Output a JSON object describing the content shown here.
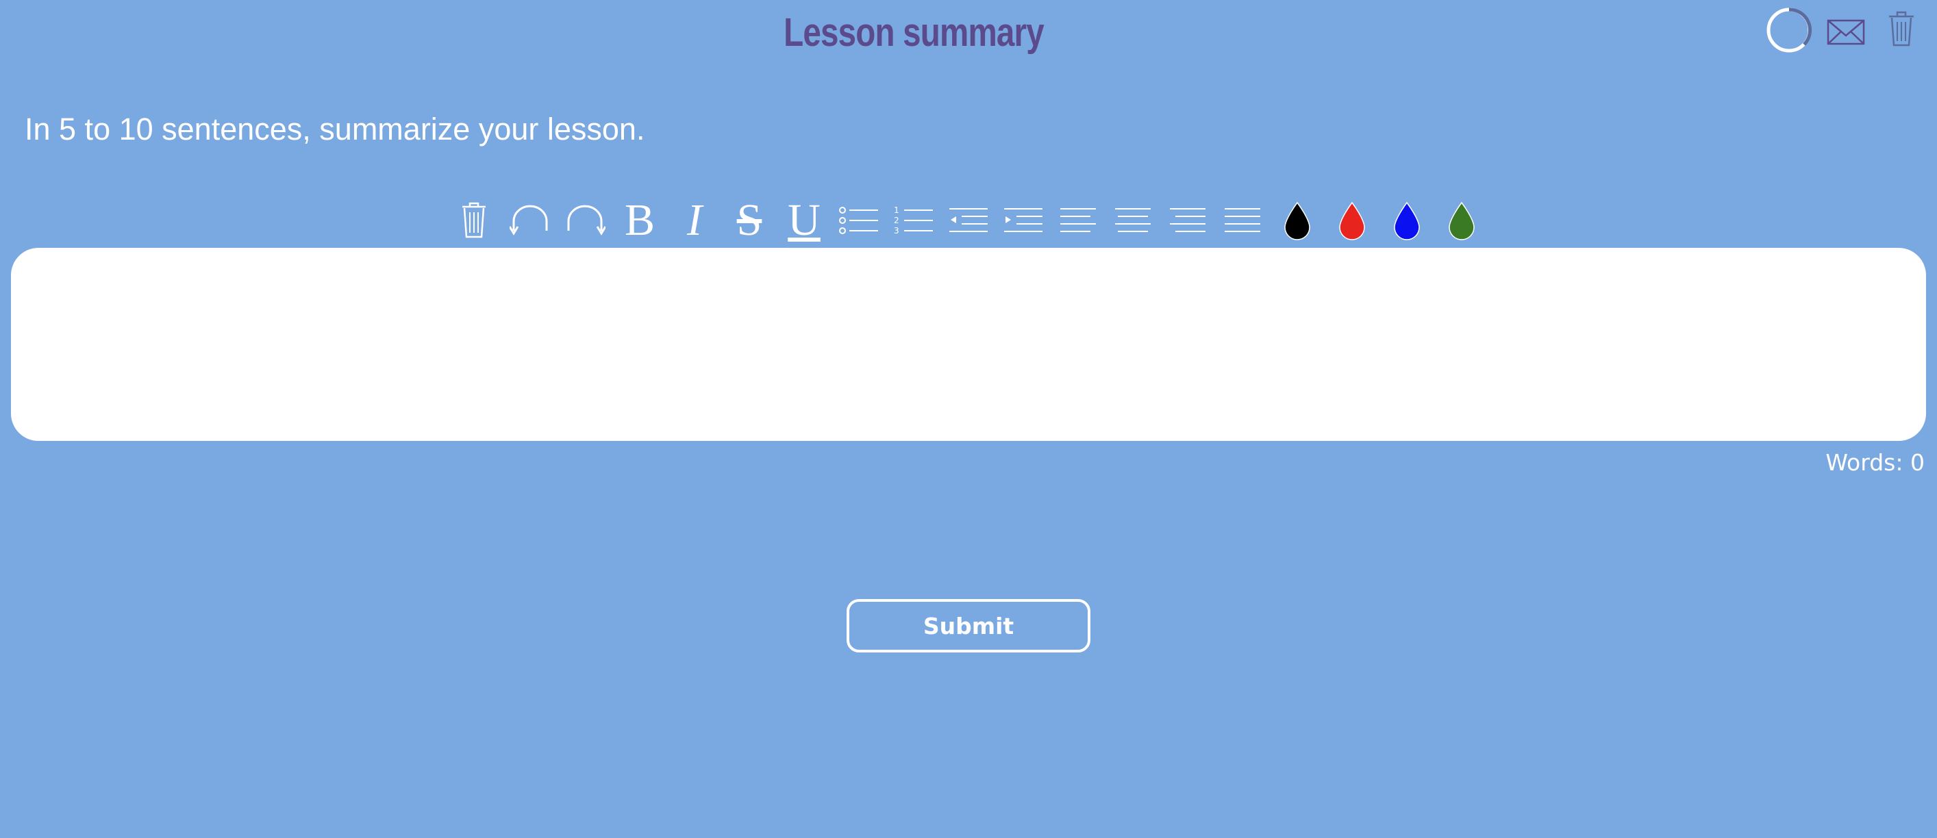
{
  "header": {
    "title": "Lesson summary",
    "title_color": "#5b4a8c",
    "icons": [
      "loading-ring-icon",
      "envelope-icon",
      "trash-icon"
    ]
  },
  "prompt": "In 5 to 10 sentences, summarize your lesson.",
  "toolbar": {
    "bold_label": "B",
    "italic_label": "I",
    "strike_label": "S",
    "underline_label": "U",
    "items": [
      "trash-icon",
      "undo-icon",
      "redo-icon",
      "bold-icon",
      "italic-icon",
      "strikethrough-icon",
      "underline-icon",
      "bullet-list-icon",
      "numbered-list-icon",
      "outdent-icon",
      "indent-icon",
      "align-left-icon",
      "align-center-icon",
      "align-right-icon",
      "align-justify-icon",
      "black-ink-icon",
      "red-ink-icon",
      "blue-ink-icon",
      "green-ink-icon"
    ],
    "ink_colors": {
      "black": "#000000",
      "red": "#e8241e",
      "blue": "#0a10f0",
      "green": "#3a7a24"
    }
  },
  "editor": {
    "value": ""
  },
  "word_count": {
    "label": "Words:",
    "value": "0"
  },
  "submit": {
    "label": "Submit"
  },
  "colors": {
    "background": "#7aa8e0",
    "text": "#ffffff"
  }
}
